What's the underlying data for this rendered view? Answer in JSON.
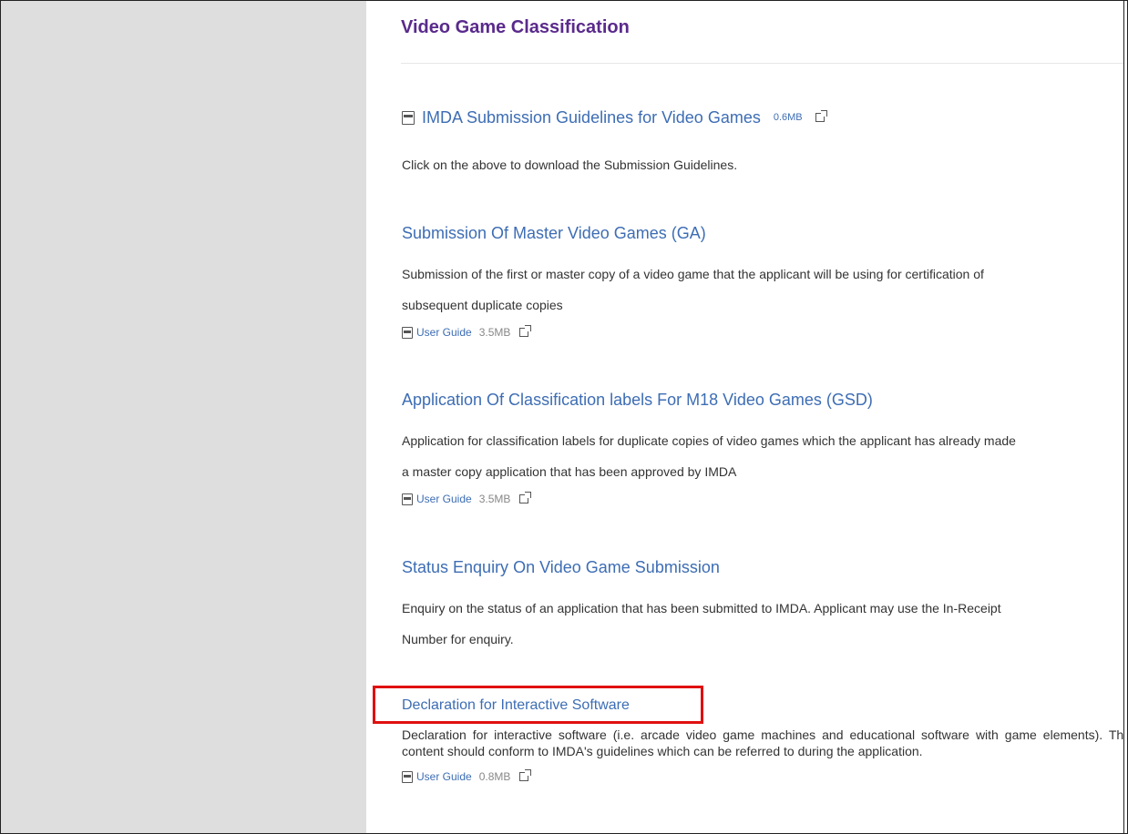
{
  "page": {
    "title": "Video Game Classification"
  },
  "guidelines": {
    "link_text": "IMDA Submission Guidelines for Video Games",
    "size": "0.6MB",
    "description": "Click on the above to download the Submission Guidelines."
  },
  "sections": [
    {
      "title": "Submission Of Master Video Games (GA)",
      "lines": [
        "Submission of the first or master copy of a video game that the applicant will be using for certification of",
        "subsequent duplicate copies"
      ],
      "guide_label": "User Guide",
      "guide_size": "3.5MB"
    },
    {
      "title": "Application Of Classification labels For M18 Video Games (GSD)",
      "lines": [
        "Application for classification labels for duplicate copies of video games which the applicant has already made",
        "a master copy application that has been approved by IMDA"
      ],
      "guide_label": "User Guide",
      "guide_size": "3.5MB"
    },
    {
      "title": "Status Enquiry On Video Game Submission",
      "lines": [
        "Enquiry on the status of an application that has been submitted to IMDA. Applicant may use the In-Receipt",
        "Number for enquiry."
      ]
    },
    {
      "title": "Declaration for Interactive Software",
      "paragraph": "Declaration for interactive software (i.e. arcade video game machines and educational software with game elements). The content should conform to IMDA's guidelines which can be referred to during the application.",
      "guide_label": "User Guide",
      "guide_size": "0.8MB"
    }
  ],
  "highlight": {
    "color": "#e01010"
  }
}
